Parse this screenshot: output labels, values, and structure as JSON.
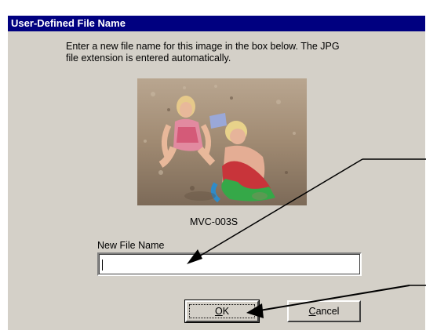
{
  "dialog": {
    "title": "User-Defined File Name",
    "instructions": "Enter a new file name for this image in the box below.  The JPG\nfile extension is entered automatically.",
    "image_caption": "MVC-003S",
    "field_label": "New File Name",
    "field_value": "",
    "ok_label": "OK",
    "ok_mnemonic": "O",
    "ok_rest": "K",
    "cancel_label": "Cancel",
    "cancel_mnemonic": "C",
    "cancel_rest": "ancel"
  },
  "colors": {
    "title_bar": "#000080",
    "dialog_face": "#d4d0c8"
  }
}
